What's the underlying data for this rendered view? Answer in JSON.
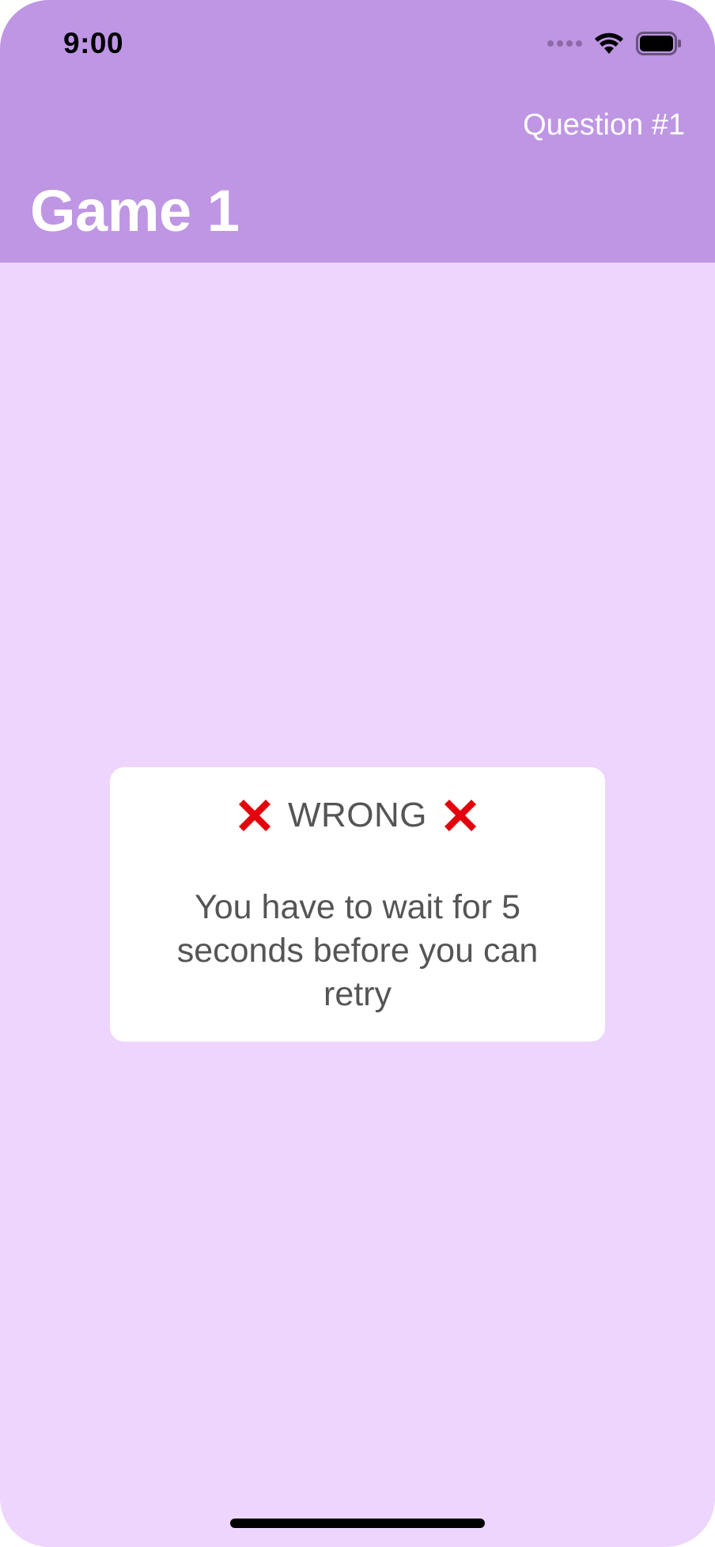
{
  "status_bar": {
    "time": "9:00"
  },
  "navbar": {
    "right_title": "Question #1",
    "large_title": "Game 1"
  },
  "alert": {
    "title": "WRONG",
    "message": "You have to wait for 5 seconds before you can retry",
    "icon_left": "x-icon",
    "icon_right": "x-icon"
  },
  "colors": {
    "navbar_bg": "#BE96E4",
    "screen_bg": "#EED5FD",
    "alert_bg": "#FFFFFF",
    "alert_text": "#555555",
    "x_icon": "#E3000F"
  }
}
